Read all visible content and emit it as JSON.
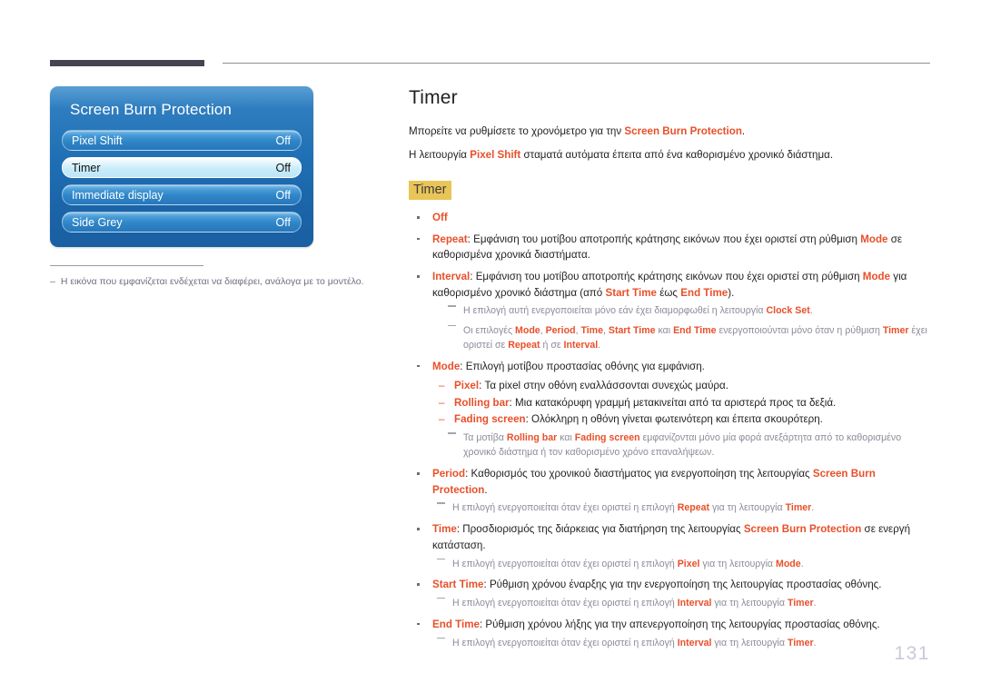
{
  "page": {
    "number": "131"
  },
  "osd": {
    "title": "Screen Burn Protection",
    "rows": [
      {
        "label": "Pixel Shift",
        "value": "Off",
        "selected": false
      },
      {
        "label": "Timer",
        "value": "Off",
        "selected": true
      },
      {
        "label": "Immediate display",
        "value": "Off",
        "selected": false
      },
      {
        "label": "Side Grey",
        "value": "Off",
        "selected": false
      }
    ]
  },
  "footnote": {
    "dash": "–",
    "text": "Η εικόνα που εμφανίζεται ενδέχεται να διαφέρει, ανάλογα με το μοντέλο."
  },
  "main": {
    "title": "Timer",
    "intro_1_pre": "Μπορείτε να ρυθμίσετε το χρονόμετρο για την ",
    "intro_1_kw": "Screen Burn Protection",
    "intro_1_post": ".",
    "intro_2_pre": "Η λειτουργία ",
    "intro_2_kw": "Pixel Shift",
    "intro_2_post": " σταματά αυτόματα έπειτα από ένα καθορισμένο χρονικό διάστημα.",
    "section_tag": "Timer",
    "item_off": "Off",
    "item_repeat_kw": "Repeat",
    "item_repeat_a": ": Εμφάνιση του μοτίβου αποτροπής κράτησης εικόνων που έχει οριστεί στη ρύθμιση ",
    "item_repeat_kw2": "Mode",
    "item_repeat_b": " σε καθορισμένα χρονικά διαστήματα.",
    "item_interval_kw": "Interval",
    "item_interval_a": ": Εμφάνιση του μοτίβου αποτροπής κράτησης εικόνων που έχει οριστεί στη ρύθμιση ",
    "item_interval_kw2": "Mode",
    "item_interval_b": " για καθορισμένο χρονικό διάστημα (από ",
    "item_interval_kw3": "Start Time",
    "item_interval_c": " έως ",
    "item_interval_kw4": "End Time",
    "item_interval_d": ").",
    "note_clock_a": "Η επιλογή αυτή ενεργοποιείται μόνο εάν έχει διαμορφωθεί η λειτουργία ",
    "note_clock_kw": "Clock Set",
    "note_clock_b": ".",
    "note_opts_a": "Οι επιλογές ",
    "note_opts_kw1": "Mode",
    "note_opts_s1": ", ",
    "note_opts_kw2": "Period",
    "note_opts_s2": ", ",
    "note_opts_kw3": "Time",
    "note_opts_s3": ", ",
    "note_opts_kw4": "Start Time",
    "note_opts_s4": " και ",
    "note_opts_kw5": "End Time",
    "note_opts_b": " ενεργοποιούνται μόνο όταν η ρύθμιση ",
    "note_opts_kw6": "Timer",
    "note_opts_c": " έχει οριστεί σε ",
    "note_opts_kw7": "Repeat",
    "note_opts_d": " ή σε ",
    "note_opts_kw8": "Interval",
    "note_opts_e": ".",
    "item_mode_kw": "Mode",
    "item_mode_a": ": Επιλογή μοτίβου προστασίας οθόνης για εμφάνιση.",
    "sub_pixel_kw": "Pixel",
    "sub_pixel_a": ": Τα pixel στην οθόνη εναλλάσσονται συνεχώς μαύρα.",
    "sub_rolling_kw": "Rolling bar",
    "sub_rolling_a": ": Μια κατακόρυφη γραμμή μετακινείται από τα αριστερά προς τα δεξιά.",
    "sub_fading_kw": "Fading screen",
    "sub_fading_a": ": Ολόκληρη η οθόνη γίνεται φωτεινότερη και έπειτα σκουρότερη.",
    "note_patterns_a": "Τα μοτίβα ",
    "note_patterns_kw1": "Rolling bar",
    "note_patterns_b": " και ",
    "note_patterns_kw2": "Fading screen",
    "note_patterns_c": " εμφανίζονται μόνο μία φορά ανεξάρτητα από το καθορισμένο χρονικό διάστημα ή τον καθορισμένο χρόνο επαναλήψεων.",
    "item_period_kw": "Period",
    "item_period_a": ": Καθορισμός του χρονικού διαστήματος για ενεργοποίηση της λειτουργίας ",
    "item_period_kw2": "Screen Burn Protection",
    "item_period_b": ".",
    "note_period_a": "Η επιλογή ενεργοποιείται όταν έχει οριστεί η επιλογή ",
    "note_period_kw1": "Repeat",
    "note_period_b": " για τη λειτουργία ",
    "note_period_kw2": "Timer",
    "note_period_c": ".",
    "item_time_kw": "Time",
    "item_time_a": ": Προσδιορισμός της διάρκειας για διατήρηση της λειτουργίας ",
    "item_time_kw2": "Screen Burn Protection",
    "item_time_b": " σε ενεργή κατάσταση.",
    "note_time_a": "Η επιλογή ενεργοποιείται όταν έχει οριστεί η επιλογή ",
    "note_time_kw1": "Pixel",
    "note_time_b": " για τη λειτουργία ",
    "note_time_kw2": "Mode",
    "note_time_c": ".",
    "item_start_kw": "Start Time",
    "item_start_a": ": Ρύθμιση χρόνου έναρξης για την ενεργοποίηση της λειτουργίας προστασίας οθόνης.",
    "note_start_a": "Η επιλογή ενεργοποιείται όταν έχει οριστεί η επιλογή ",
    "note_start_kw1": "Interval",
    "note_start_b": " για τη λειτουργία ",
    "note_start_kw2": "Timer",
    "note_start_c": ".",
    "item_end_kw": "End Time",
    "item_end_a": ": Ρύθμιση χρόνου λήξης για την απενεργοποίηση της λειτουργίας προστασίας οθόνης.",
    "note_end_a": "Η επιλογή ενεργοποιείται όταν έχει οριστεί η επιλογή ",
    "note_end_kw1": "Interval",
    "note_end_b": " για τη λειτουργία ",
    "note_end_kw2": "Timer",
    "note_end_c": ".",
    "sub_dash": "–"
  },
  "colors": {
    "keyword": "#e8502a",
    "highlight": "#e9c558",
    "osd_blue": "#1f6fb4",
    "note_gray": "#8c8c99",
    "rule_dark": "#484351"
  }
}
